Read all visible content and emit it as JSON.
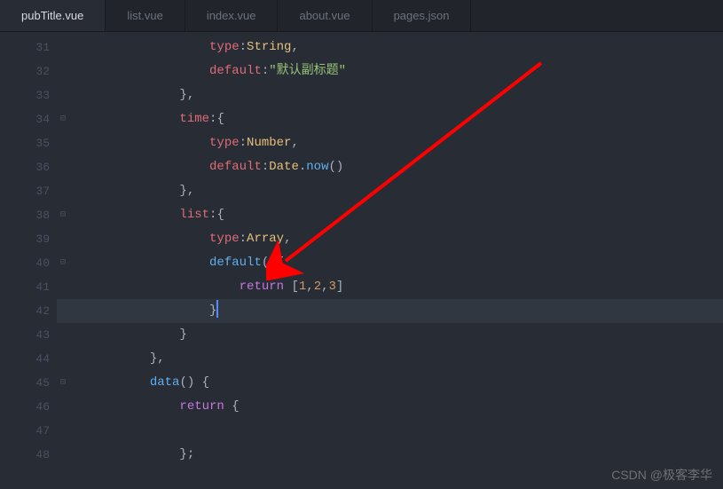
{
  "tabs": [
    {
      "label": "pubTitle.vue",
      "active": true
    },
    {
      "label": "list.vue",
      "active": false
    },
    {
      "label": "index.vue",
      "active": false
    },
    {
      "label": "about.vue",
      "active": false
    },
    {
      "label": "pages.json",
      "active": false
    }
  ],
  "lines": [
    {
      "num": "31",
      "fold": ""
    },
    {
      "num": "32",
      "fold": ""
    },
    {
      "num": "33",
      "fold": ""
    },
    {
      "num": "34",
      "fold": "⊟"
    },
    {
      "num": "35",
      "fold": ""
    },
    {
      "num": "36",
      "fold": ""
    },
    {
      "num": "37",
      "fold": ""
    },
    {
      "num": "38",
      "fold": "⊟"
    },
    {
      "num": "39",
      "fold": ""
    },
    {
      "num": "40",
      "fold": "⊟"
    },
    {
      "num": "41",
      "fold": ""
    },
    {
      "num": "42",
      "fold": ""
    },
    {
      "num": "43",
      "fold": ""
    },
    {
      "num": "44",
      "fold": ""
    },
    {
      "num": "45",
      "fold": "⊟"
    },
    {
      "num": "46",
      "fold": ""
    },
    {
      "num": "47",
      "fold": ""
    },
    {
      "num": "48",
      "fold": ""
    }
  ],
  "code": {
    "l31": {
      "indent": "                    ",
      "prop": "type",
      "colon": ":",
      "value": "String",
      "comma": ","
    },
    "l32": {
      "indent": "                    ",
      "prop": "default",
      "colon": ":",
      "q1": "\"",
      "str": "默认副标题",
      "q2": "\""
    },
    "l33": {
      "indent": "                ",
      "close": "},"
    },
    "l34": {
      "indent": "                ",
      "prop": "time",
      "colon": ":",
      "brace": "{"
    },
    "l35": {
      "indent": "                    ",
      "prop": "type",
      "colon": ":",
      "value": "Number",
      "comma": ","
    },
    "l36": {
      "indent": "                    ",
      "prop": "default",
      "colon": ":",
      "cls": "Date",
      "dot": ".",
      "method": "now",
      "parens": "()"
    },
    "l37": {
      "indent": "                ",
      "close": "},"
    },
    "l38": {
      "indent": "                ",
      "prop": "list",
      "colon": ":",
      "brace": "{"
    },
    "l39": {
      "indent": "                    ",
      "prop": "type",
      "colon": ":",
      "value": "Array",
      "comma": ","
    },
    "l40": {
      "indent": "                    ",
      "method": "default",
      "parens": "()",
      "brace": "{"
    },
    "l41": {
      "indent": "                        ",
      "kw": "return",
      "sp": " ",
      "lb": "[",
      "n1": "1",
      "c1": ",",
      "n2": "2",
      "c2": ",",
      "n3": "3",
      "rb": "]"
    },
    "l42": {
      "indent": "                    ",
      "close": "}"
    },
    "l43": {
      "indent": "                ",
      "close": "}"
    },
    "l44": {
      "indent": "            ",
      "close": "},"
    },
    "l45": {
      "indent": "            ",
      "method": "data",
      "parens": "()",
      "sp": " ",
      "brace": "{"
    },
    "l46": {
      "indent": "                ",
      "kw": "return",
      "sp": " ",
      "brace": "{"
    },
    "l47": {
      "indent": ""
    },
    "l48": {
      "indent": "                ",
      "close": "};"
    }
  },
  "watermark": "CSDN @极客李华"
}
